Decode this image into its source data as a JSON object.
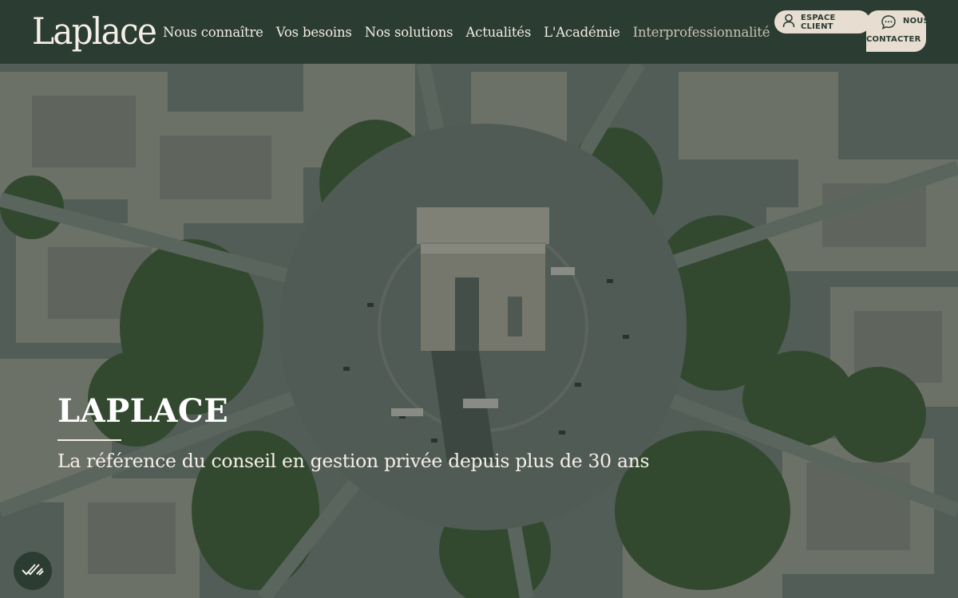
{
  "header": {
    "logo_text": "Laplace",
    "nav": [
      {
        "label": "Nous connaître"
      },
      {
        "label": "Vos besoins"
      },
      {
        "label": "Nos solutions"
      },
      {
        "label": "Actualités"
      },
      {
        "label": "L'Académie"
      },
      {
        "label": "Interprofessionnalité"
      }
    ],
    "client_button": {
      "label": "ESPACE CLIENT",
      "icon": "user-icon"
    },
    "contact_button": {
      "label_line1": "NOUS",
      "label_line2": "CONTACTER",
      "icon": "chat-icon"
    }
  },
  "hero": {
    "title": "LAPLACE",
    "subtitle": "La référence du conseil en gestion privée depuis plus de 30 ans",
    "consent_icon": "double-check-icon"
  },
  "colors": {
    "header_bg": "#2b3c33",
    "pill_bg": "#e7ddd0",
    "text_light": "#f2ede4"
  }
}
